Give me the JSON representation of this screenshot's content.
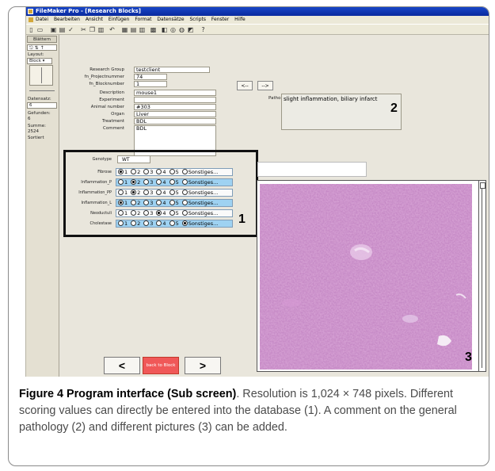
{
  "window": {
    "title": "FileMaker Pro - [Research Blocks]",
    "menu": [
      "Datei",
      "Bearbeiten",
      "Ansicht",
      "Einfügen",
      "Format",
      "Datensätze",
      "Scripts",
      "Fenster",
      "Hilfe"
    ]
  },
  "status": {
    "tab": "Blättern",
    "layout_label": "Layout:",
    "layout_value": "Block",
    "record_label": "Datensatz:",
    "record_value": "6",
    "found_label": "Gefunden:",
    "found_value": "6",
    "total_label": "Summe:",
    "total_value": "2524",
    "sort_label": "Sortiert"
  },
  "form": {
    "fields": [
      {
        "label": "Research Group",
        "value": "testclient"
      },
      {
        "label": "fn_Projectnummer",
        "value": "74"
      },
      {
        "label": "fn_Blocknumber",
        "value": "1"
      },
      {
        "label": "Description",
        "value": "mouse1"
      },
      {
        "label": "Experiment",
        "value": ""
      },
      {
        "label": "Animal number",
        "value": "#303"
      },
      {
        "label": "Organ",
        "value": "Liver"
      },
      {
        "label": "Treatment",
        "value": "BDL"
      },
      {
        "label": "Comment",
        "value": "BDL"
      }
    ],
    "nav_prev": "<--",
    "nav_next": "-->",
    "pathology_label": "Pathology",
    "pathology_value": "slight inflammation, biliary infarct",
    "genotype_label": "Genotype",
    "genotype_value": "WT",
    "scores": [
      {
        "label": "Fibrose",
        "selected": 1,
        "row_color": "white"
      },
      {
        "label": "Inflammation_P",
        "selected": 2,
        "row_color": "blue"
      },
      {
        "label": "Inflammation_PP",
        "selected": 2,
        "row_color": "white"
      },
      {
        "label": "Inflammation_L",
        "selected": 1,
        "row_color": "blue"
      },
      {
        "label": "Neoductuli",
        "selected": 4,
        "row_color": "white"
      },
      {
        "label": "Cholestase",
        "selected": 6,
        "row_color": "blue"
      }
    ],
    "options": [
      "1",
      "2",
      "3",
      "4",
      "5",
      "Sonstiges..."
    ],
    "marker_1": "1",
    "marker_2": "2",
    "marker_3": "3",
    "btn_prev": "<",
    "btn_back": "back to Block list",
    "btn_next": ">",
    "accent_back": "#f05858",
    "accent_row": "#9ed2f2"
  },
  "caption": {
    "label": "Figure 4 Program interface (Sub screen)",
    "text": ". Resolution is 1,024 × 748 pixels. Different scoring values can directly be entered into the database (1). A comment on the general pathology (2) and different pictures (3) can be added."
  }
}
